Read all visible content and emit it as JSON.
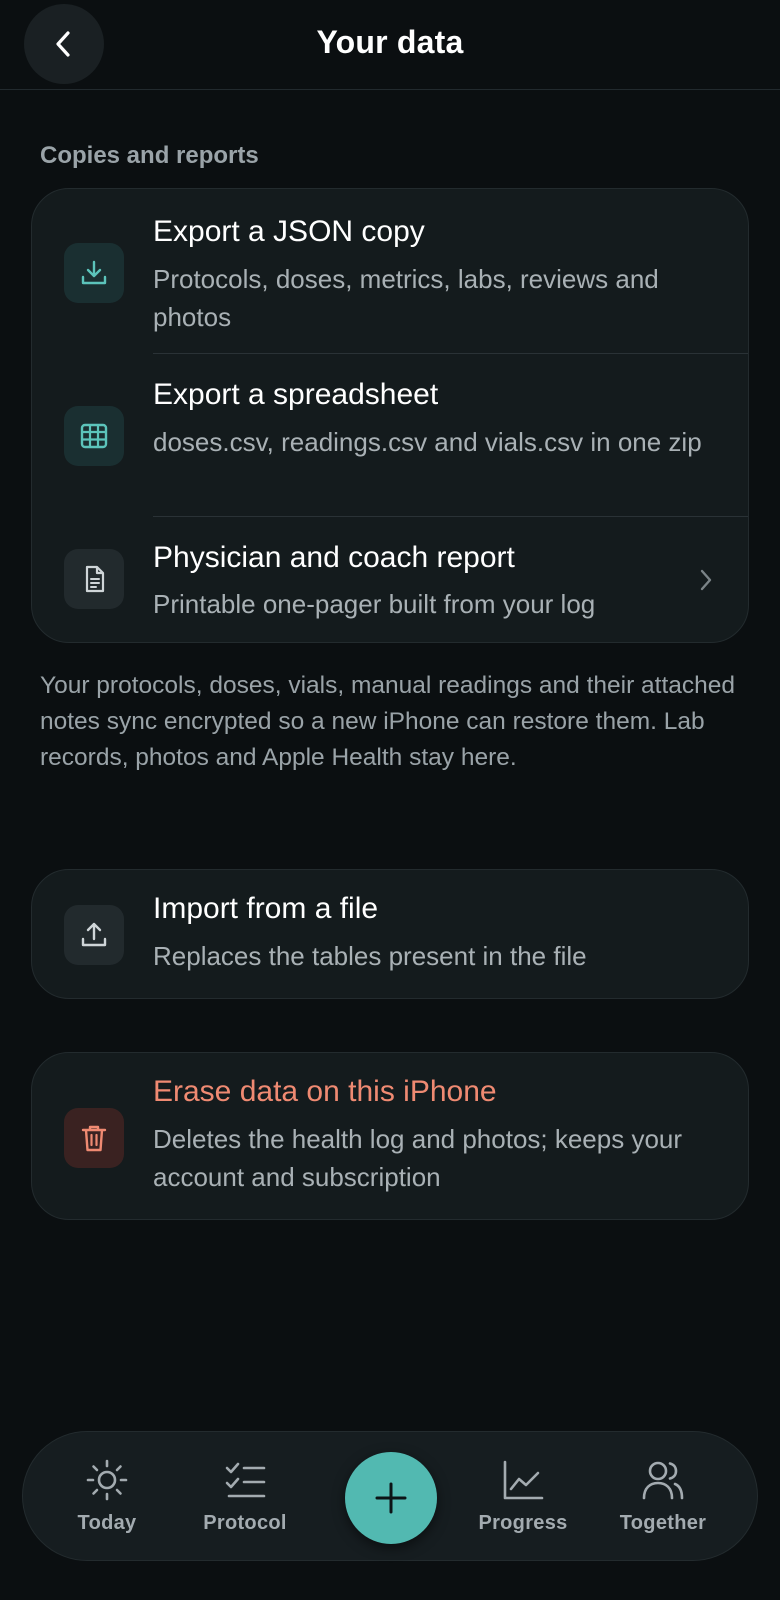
{
  "header": {
    "title": "Your data"
  },
  "copies_section": {
    "label": "Copies and reports",
    "items": [
      {
        "title": "Export a JSON copy",
        "subtitle": "Protocols, doses, metrics, labs, reviews and photos",
        "icon": "download-icon"
      },
      {
        "title": "Export a spreadsheet",
        "subtitle": "doses.csv, readings.csv and vials.csv in one zip",
        "icon": "table-icon"
      },
      {
        "title": "Physician and coach report",
        "subtitle": "Printable one-pager built from your log",
        "icon": "document-icon"
      }
    ],
    "footnote": "Your protocols, doses, vials, manual readings and their attached notes sync encrypted so a new iPhone can restore them. Lab records, photos and Apple Health stay here."
  },
  "import": {
    "title": "Import from a file",
    "subtitle": "Replaces the tables present in the file",
    "icon": "upload-icon"
  },
  "erase": {
    "title": "Erase data on this iPhone",
    "subtitle": "Deletes the health log and photos; keeps your account and subscription",
    "icon": "trash-icon"
  },
  "tabbar": {
    "tabs": [
      {
        "label": "Today",
        "icon": "sun-icon"
      },
      {
        "label": "Protocol",
        "icon": "checklist-icon"
      },
      {
        "label": "Progress",
        "icon": "chart-icon"
      },
      {
        "label": "Together",
        "icon": "people-icon"
      }
    ],
    "fab_icon": "plus-icon"
  },
  "colors": {
    "accent": "#52b9b1",
    "danger": "#ef8a72",
    "background": "#0b0f11",
    "card": "#141b1d"
  }
}
